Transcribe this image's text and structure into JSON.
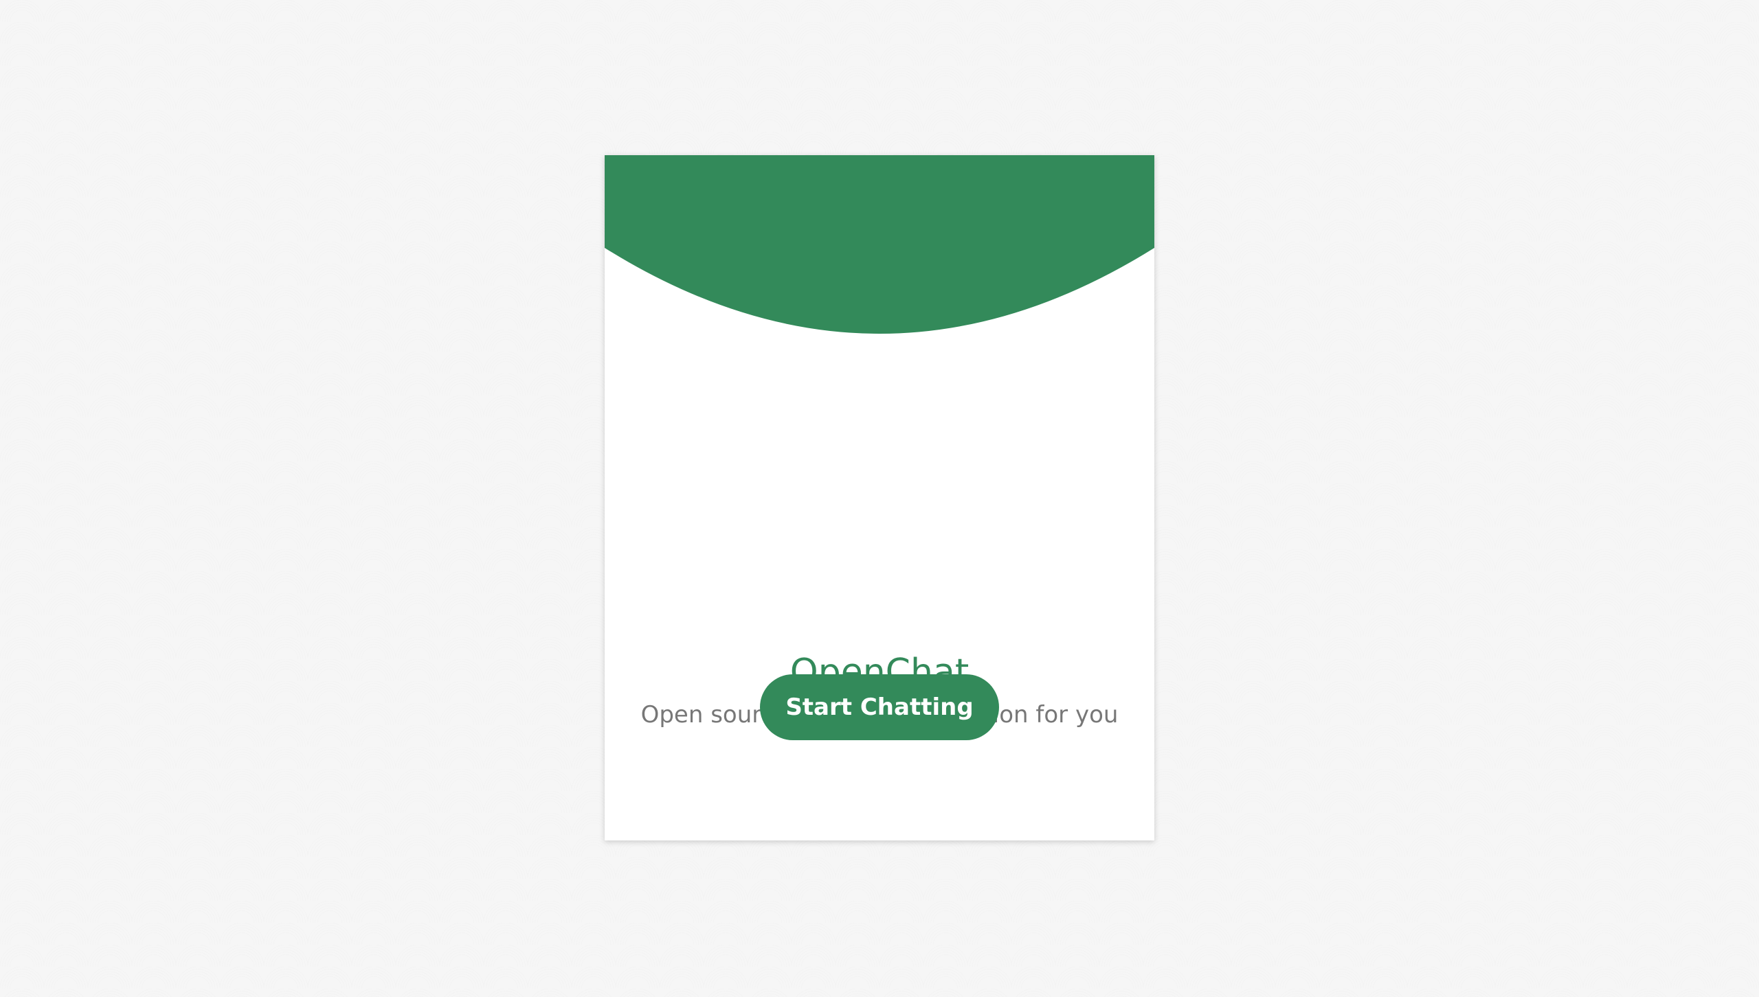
{
  "app": {
    "title": "OpenChat",
    "tagline": "Open source chatting application for you"
  },
  "actions": {
    "start_label": "Start Chatting"
  },
  "colors": {
    "accent": "#338a5a",
    "card": "#ffffff",
    "subtitle": "#777777",
    "background": "#f4f4f4"
  }
}
